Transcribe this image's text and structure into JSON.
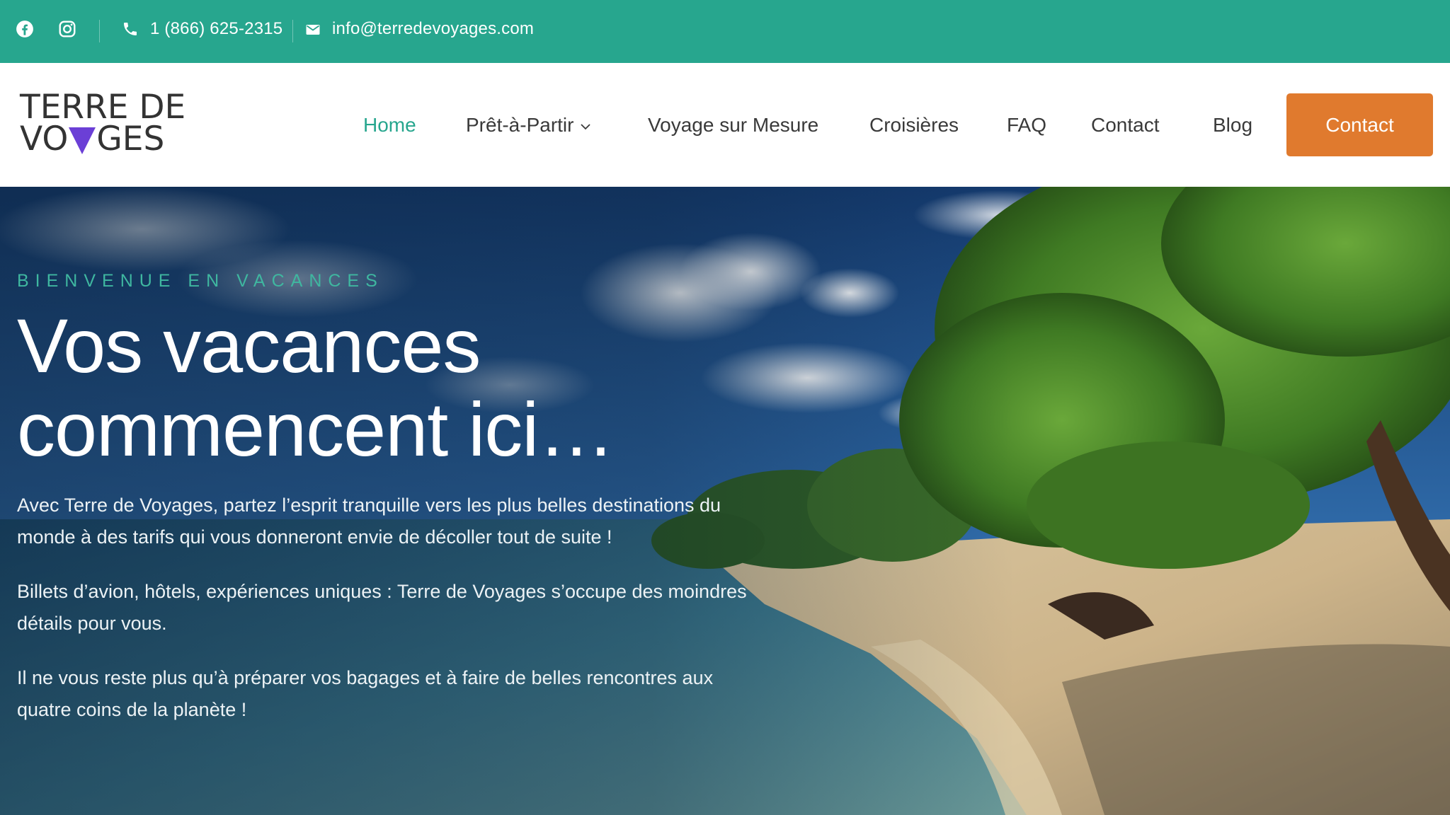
{
  "topbar": {
    "phone": "1 (866) 625-2315",
    "email": "info@terredevoyages.com",
    "icons": [
      "facebook-icon",
      "instagram-icon",
      "phone-icon",
      "mail-icon"
    ]
  },
  "logo": {
    "line1": "TERRE DE",
    "line2_prefix": "VO",
    "line2_suffix": "GES"
  },
  "nav": {
    "items": [
      {
        "label": "Home",
        "active": true
      },
      {
        "label": "Prêt-à-Partir",
        "dropdown": true
      },
      {
        "label": "Voyage sur Mesure"
      },
      {
        "label": "Croisières"
      },
      {
        "label": "FAQ"
      },
      {
        "label": "Contact"
      },
      {
        "label": "Blog"
      }
    ],
    "cta_label": "Contact"
  },
  "hero": {
    "eyebrow": "BIENVENUE EN VACANCES",
    "title_line1": "Vos vacances",
    "title_line2": "commencent ici…",
    "paragraphs": [
      "Avec Terre de Voyages, partez l’esprit tranquille vers les plus belles destinations du monde à des tarifs qui vous donneront envie de décoller tout de suite !",
      "Billets d’avion, hôtels, expériences uniques : Terre de Voyages s’occupe des moindres détails pour vous.",
      "Il ne vous reste plus qu’à préparer vos bagages et à faire de belles rencontres aux quatre coins de la planète !"
    ]
  },
  "colors": {
    "brand_teal": "#27a68e",
    "cta_orange": "#e07a2e",
    "logo_purple": "#6b3fd6",
    "nav_text": "#3a3a3a"
  }
}
